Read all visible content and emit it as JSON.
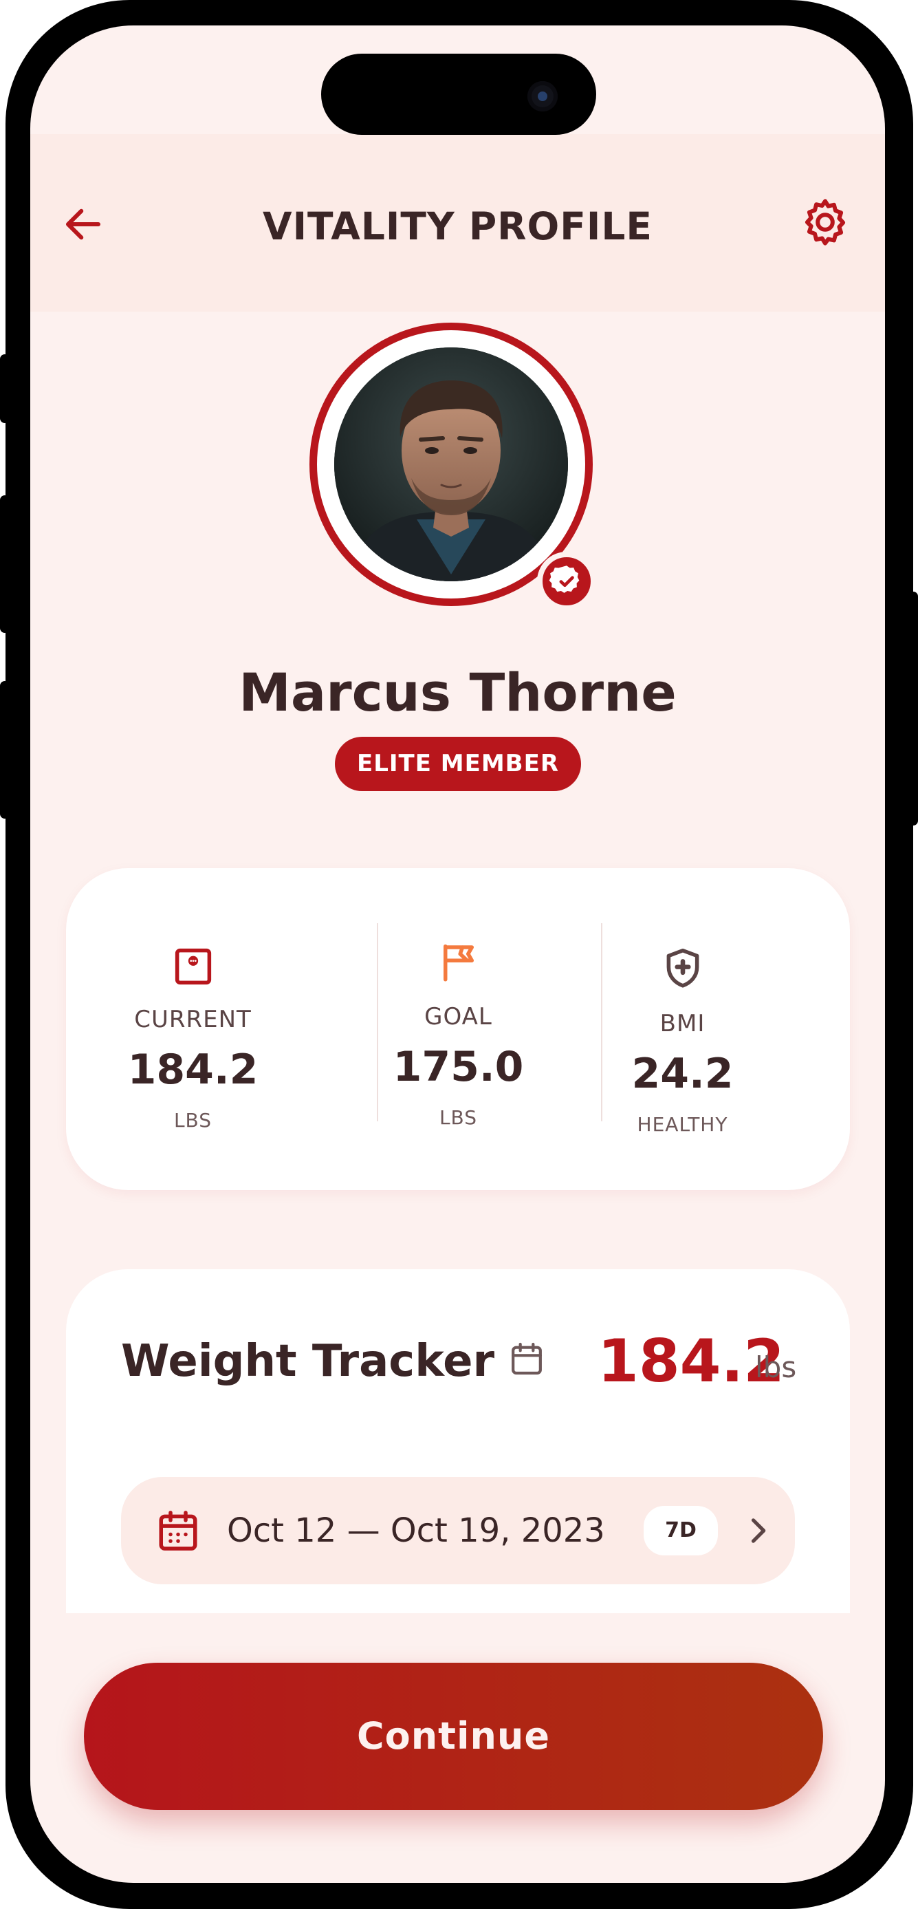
{
  "header": {
    "title": "VITALITY PROFILE"
  },
  "profile": {
    "name": "Marcus Thorne",
    "badge": "ELITE MEMBER"
  },
  "stats": [
    {
      "label": "CURRENT",
      "value": "184.2",
      "unit": "LBS",
      "icon": "scale-icon"
    },
    {
      "label": "GOAL",
      "value": "175.0",
      "unit": "LBS",
      "icon": "flag-icon"
    },
    {
      "label": "BMI",
      "value": "24.2",
      "unit": "HEALTHY",
      "icon": "shield-plus-icon"
    }
  ],
  "tracker": {
    "title": "Weight Tracker",
    "value": "184.2",
    "unit": "lbs",
    "date_range": "Oct 12 — Oct 19, 2023",
    "range_chip": "7D"
  },
  "actions": {
    "continue_label": "Continue"
  },
  "colors": {
    "accent": "#b8161c",
    "orange": "#f47a3e",
    "text_dark": "#3a2526",
    "background": "#fdf1ef"
  }
}
